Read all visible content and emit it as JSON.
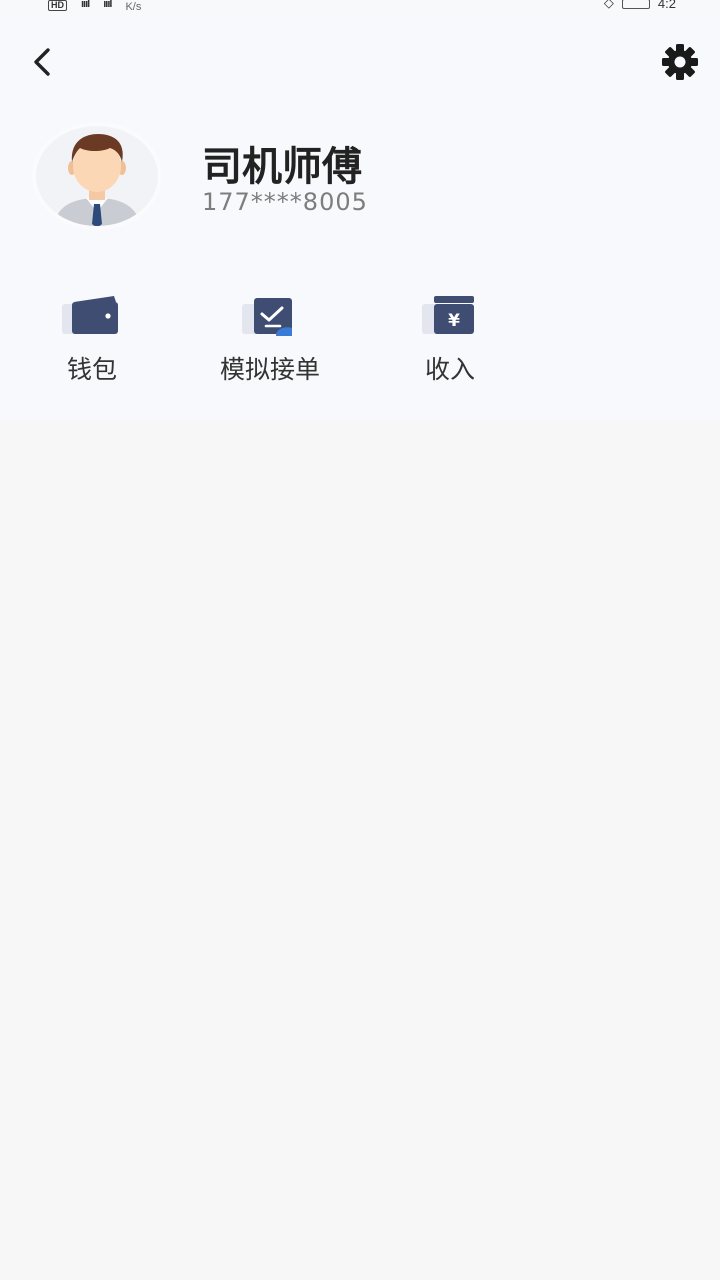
{
  "status_bar": {
    "left_badge": "HD",
    "signal_1": "ıııl",
    "signal_2": "ıııl",
    "network_speed": "K/s",
    "time": "4:2"
  },
  "profile": {
    "name": "司机师傅",
    "phone": "177****8005"
  },
  "quick_actions": [
    {
      "label": "钱包",
      "icon": "wallet-icon"
    },
    {
      "label": "模拟接单",
      "icon": "order-check-icon"
    },
    {
      "label": "收入",
      "icon": "yen-income-icon"
    }
  ],
  "colors": {
    "icon_primary": "#3f4d73",
    "icon_secondary": "#e3e6ee",
    "icon_accent": "#3a7bd5",
    "panel_bg": "#f8f9fc",
    "page_bg": "#f7f7f7"
  }
}
